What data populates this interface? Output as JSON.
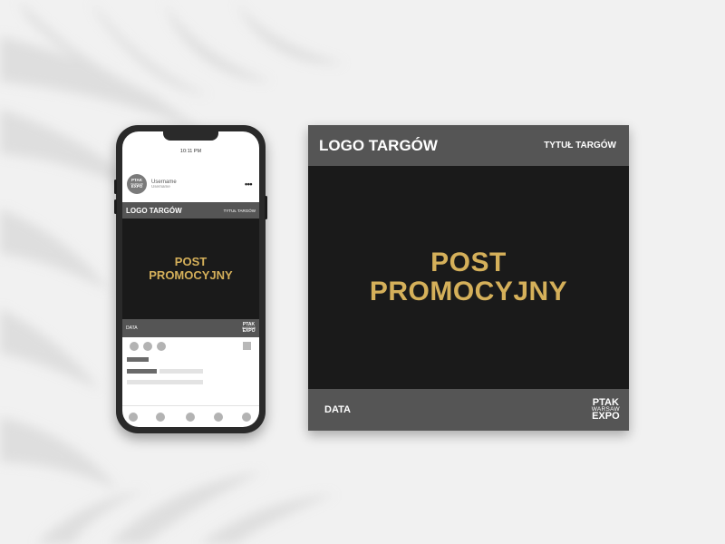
{
  "colors": {
    "background": "#f1f1f1",
    "header_bar": "#555555",
    "post_body": "#1a1a1a",
    "accent_gold": "#d5b05a",
    "phone_frame": "#2a2a2a"
  },
  "phone": {
    "status_time": "10:11 PM",
    "profile": {
      "avatar_lines": [
        "PTAK",
        "WARSAW",
        "EXPO"
      ],
      "username": "Username",
      "handle": "Username",
      "more_icon": "more-horizontal-icon"
    },
    "post": {
      "logo": "LOGO TARGÓW",
      "title": "TYTUŁ TARGÓW",
      "text_line1": "POST",
      "text_line2": "PROMOCYJNY",
      "date": "DATA",
      "brand": [
        "PTAK",
        "WARSAW",
        "EXPO"
      ]
    }
  },
  "post": {
    "logo": "LOGO TARGÓW",
    "title": "TYTUŁ TARGÓW",
    "text_line1": "POST",
    "text_line2": "PROMOCYJNY",
    "date": "DATA",
    "brand": [
      "PTAK",
      "WARSAW",
      "EXPO"
    ]
  }
}
